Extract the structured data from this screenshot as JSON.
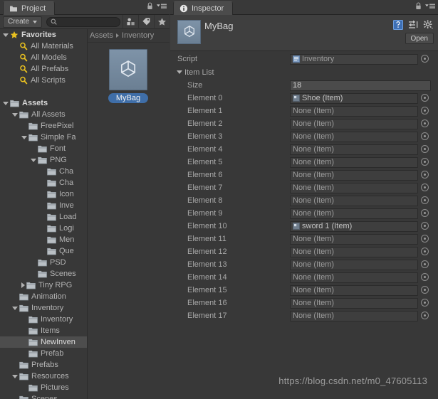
{
  "project": {
    "tab": {
      "label": "Project",
      "icon": "folder-icon"
    },
    "toolbar": {
      "create_label": "Create",
      "search_placeholder": "",
      "search_value": "",
      "icons": [
        "filter-by-type-icon",
        "filter-by-label-icon",
        "filter-by-favorite-icon"
      ]
    },
    "tree": [
      {
        "label": "Favorites",
        "indent": 0,
        "twisty": "open",
        "icon": "star-icon",
        "bold": true,
        "selected": false
      },
      {
        "label": "All Materials",
        "indent": 1,
        "twisty": "none",
        "icon": "search-icon",
        "bold": false,
        "selected": false
      },
      {
        "label": "All Models",
        "indent": 1,
        "twisty": "none",
        "icon": "search-icon",
        "bold": false,
        "selected": false
      },
      {
        "label": "All Prefabs",
        "indent": 1,
        "twisty": "none",
        "icon": "search-icon",
        "bold": false,
        "selected": false
      },
      {
        "label": "All Scripts",
        "indent": 1,
        "twisty": "none",
        "icon": "search-icon",
        "bold": false,
        "selected": false
      },
      {
        "label": "",
        "indent": 0,
        "twisty": "none",
        "icon": "spacer",
        "bold": false,
        "selected": false
      },
      {
        "label": "Assets",
        "indent": 0,
        "twisty": "open",
        "icon": "folder-icon",
        "bold": true,
        "selected": false
      },
      {
        "label": "All Assets",
        "indent": 1,
        "twisty": "open",
        "icon": "folder-icon",
        "bold": false,
        "selected": false
      },
      {
        "label": "FreePixel",
        "indent": 2,
        "twisty": "none",
        "icon": "folder-icon",
        "bold": false,
        "selected": false
      },
      {
        "label": "Simple Fa",
        "indent": 2,
        "twisty": "open",
        "icon": "folder-icon",
        "bold": false,
        "selected": false
      },
      {
        "label": "Font",
        "indent": 3,
        "twisty": "none",
        "icon": "folder-icon",
        "bold": false,
        "selected": false
      },
      {
        "label": "PNG",
        "indent": 3,
        "twisty": "open",
        "icon": "folder-icon",
        "bold": false,
        "selected": false
      },
      {
        "label": "Cha",
        "indent": 4,
        "twisty": "none",
        "icon": "folder-icon",
        "bold": false,
        "selected": false
      },
      {
        "label": "Cha",
        "indent": 4,
        "twisty": "none",
        "icon": "folder-icon",
        "bold": false,
        "selected": false
      },
      {
        "label": "Icon",
        "indent": 4,
        "twisty": "none",
        "icon": "folder-icon",
        "bold": false,
        "selected": false
      },
      {
        "label": "Inve",
        "indent": 4,
        "twisty": "none",
        "icon": "folder-icon",
        "bold": false,
        "selected": false
      },
      {
        "label": "Load",
        "indent": 4,
        "twisty": "none",
        "icon": "folder-icon",
        "bold": false,
        "selected": false
      },
      {
        "label": "Logi",
        "indent": 4,
        "twisty": "none",
        "icon": "folder-icon",
        "bold": false,
        "selected": false
      },
      {
        "label": "Men",
        "indent": 4,
        "twisty": "none",
        "icon": "folder-icon",
        "bold": false,
        "selected": false
      },
      {
        "label": "Que",
        "indent": 4,
        "twisty": "none",
        "icon": "folder-icon",
        "bold": false,
        "selected": false
      },
      {
        "label": "PSD",
        "indent": 3,
        "twisty": "none",
        "icon": "folder-icon",
        "bold": false,
        "selected": false
      },
      {
        "label": "Scenes",
        "indent": 3,
        "twisty": "none",
        "icon": "folder-icon",
        "bold": false,
        "selected": false
      },
      {
        "label": "Tiny RPG",
        "indent": 2,
        "twisty": "closed",
        "icon": "folder-icon",
        "bold": false,
        "selected": false
      },
      {
        "label": "Animation",
        "indent": 1,
        "twisty": "none",
        "icon": "folder-icon",
        "bold": false,
        "selected": false
      },
      {
        "label": "Inventory",
        "indent": 1,
        "twisty": "open",
        "icon": "folder-icon",
        "bold": false,
        "selected": false
      },
      {
        "label": "Inventory",
        "indent": 2,
        "twisty": "none",
        "icon": "folder-icon",
        "bold": false,
        "selected": false
      },
      {
        "label": "Items",
        "indent": 2,
        "twisty": "none",
        "icon": "folder-icon",
        "bold": false,
        "selected": false
      },
      {
        "label": "NewInven",
        "indent": 2,
        "twisty": "none",
        "icon": "folder-icon",
        "bold": false,
        "selected": true
      },
      {
        "label": "Prefab",
        "indent": 2,
        "twisty": "none",
        "icon": "folder-icon",
        "bold": false,
        "selected": false
      },
      {
        "label": "Prefabs",
        "indent": 1,
        "twisty": "none",
        "icon": "folder-icon",
        "bold": false,
        "selected": false
      },
      {
        "label": "Resources",
        "indent": 1,
        "twisty": "open",
        "icon": "folder-icon",
        "bold": false,
        "selected": false
      },
      {
        "label": "Pictures",
        "indent": 2,
        "twisty": "none",
        "icon": "folder-icon",
        "bold": false,
        "selected": false
      },
      {
        "label": "Scenes",
        "indent": 1,
        "twisty": "none",
        "icon": "folder-icon",
        "bold": false,
        "selected": false
      }
    ],
    "breadcrumb": {
      "root": "Assets",
      "current": "Inventory"
    },
    "asset": {
      "name": "MyBag",
      "thumb_icon": "unity-asset-icon"
    }
  },
  "inspector": {
    "tab": {
      "label": "Inspector",
      "icon": "info-icon"
    },
    "title": "MyBag",
    "thumb_icon": "unity-asset-icon",
    "header_icons": [
      "help-icon",
      "preset-icon",
      "settings-gear-icon"
    ],
    "open_label": "Open",
    "script": {
      "label": "Script",
      "value": "Inventory"
    },
    "item_list": {
      "label": "Item List",
      "size_label": "Size",
      "size_value": "18",
      "none_value": "None (Item)",
      "elements": [
        {
          "label": "Element 0",
          "value": "Shoe (Item)",
          "assigned": true
        },
        {
          "label": "Element 1",
          "value": "None (Item)",
          "assigned": false
        },
        {
          "label": "Element 2",
          "value": "None (Item)",
          "assigned": false
        },
        {
          "label": "Element 3",
          "value": "None (Item)",
          "assigned": false
        },
        {
          "label": "Element 4",
          "value": "None (Item)",
          "assigned": false
        },
        {
          "label": "Element 5",
          "value": "None (Item)",
          "assigned": false
        },
        {
          "label": "Element 6",
          "value": "None (Item)",
          "assigned": false
        },
        {
          "label": "Element 7",
          "value": "None (Item)",
          "assigned": false
        },
        {
          "label": "Element 8",
          "value": "None (Item)",
          "assigned": false
        },
        {
          "label": "Element 9",
          "value": "None (Item)",
          "assigned": false
        },
        {
          "label": "Element 10",
          "value": "sword 1 (Item)",
          "assigned": true
        },
        {
          "label": "Element 11",
          "value": "None (Item)",
          "assigned": false
        },
        {
          "label": "Element 12",
          "value": "None (Item)",
          "assigned": false
        },
        {
          "label": "Element 13",
          "value": "None (Item)",
          "assigned": false
        },
        {
          "label": "Element 14",
          "value": "None (Item)",
          "assigned": false
        },
        {
          "label": "Element 15",
          "value": "None (Item)",
          "assigned": false
        },
        {
          "label": "Element 16",
          "value": "None (Item)",
          "assigned": false
        },
        {
          "label": "Element 17",
          "value": "None (Item)",
          "assigned": false
        }
      ]
    }
  },
  "watermark": "https://blog.csdn.net/m0_47605113",
  "colors": {
    "window_bg": "#383838",
    "panel_header": "#3f3f3f",
    "tab_active": "#4b4b4b",
    "selection_blue": "#3f6ea8",
    "row_selected": "#4d4d4d",
    "favorite_yellow": "#e8c020",
    "text_primary": "#b8b8b8"
  }
}
